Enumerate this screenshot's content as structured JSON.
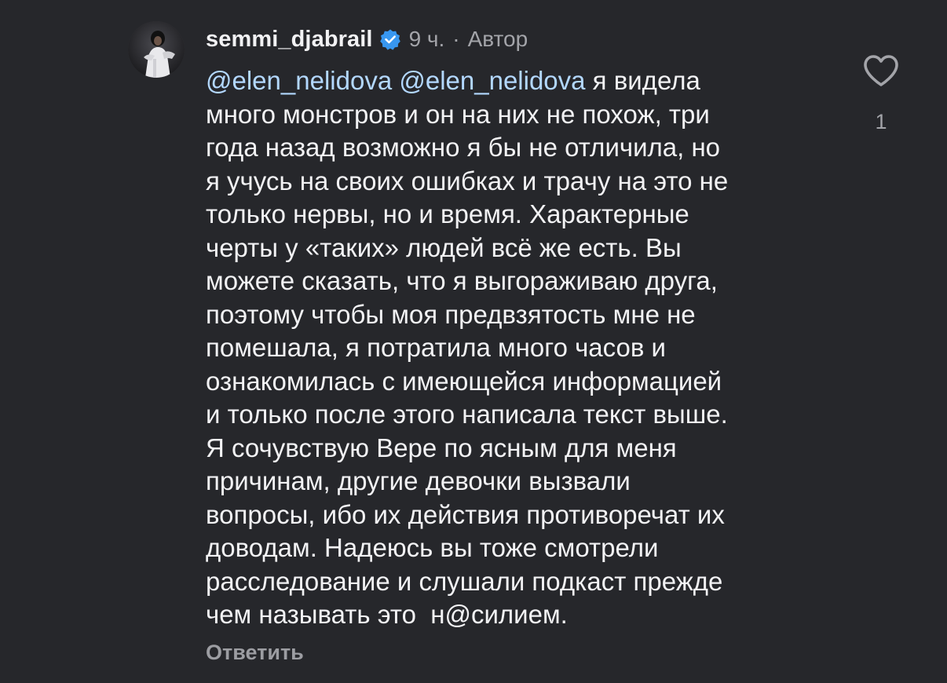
{
  "comment": {
    "author": {
      "username": "semmi_djabrail",
      "verified": true,
      "avatar_icon": "avatar-photo"
    },
    "time": "9 ч.",
    "separator": "·",
    "role_badge": "Автор",
    "mentions": [
      "@elen_nelidova",
      "@elen_nelidova"
    ],
    "text_lines": [
      " я видела",
      "много монстров и он на них не похож, три",
      "года назад возможно я бы не отличила, но",
      "я учусь на своих ошибках и трачу на это не",
      "только нервы, но и время. Характерные",
      "черты у «таких» людей всё же есть. Вы",
      "можете сказать, что я выгораживаю друга,",
      "поэтому чтобы моя предвзятость мне не",
      "помешала, я потратила много часов и",
      "ознакомилась с имеющейся информацией",
      "и только после этого написала текст выше.",
      "Я сочувствую Вере по ясным для меня",
      "причинам, другие девочки вызвали",
      "вопросы, ибо их действия противоречат их",
      "доводам. Надеюсь вы тоже смотрели",
      "расследование и слушали подкаст прежде",
      "чем называть это  н@силием."
    ],
    "reply_label": "Ответить",
    "likes": {
      "icon": "heart-outline-icon",
      "count": "1"
    }
  },
  "colors": {
    "background": "#26272b",
    "text": "#f2f2f4",
    "secondary_text": "#a3a4a9",
    "mention": "#b3d8ff",
    "verified_badge": "#3897f0"
  }
}
